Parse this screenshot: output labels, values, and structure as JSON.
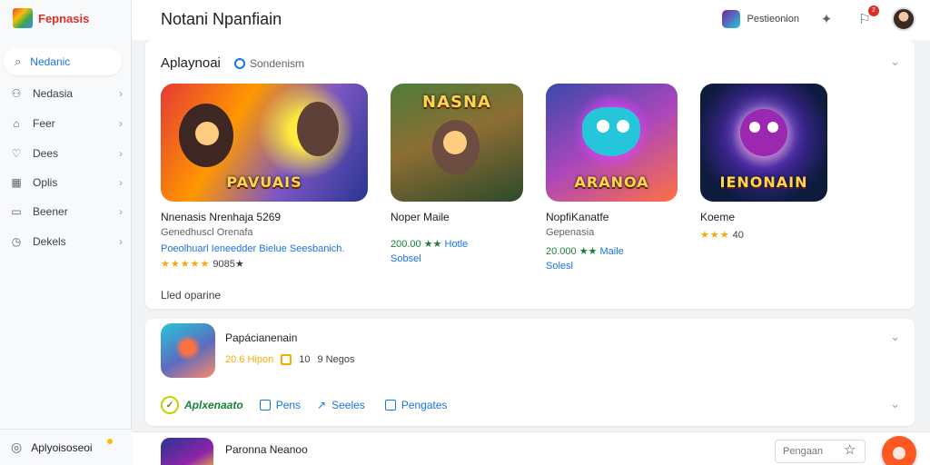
{
  "brand": {
    "name": "Fepnasis"
  },
  "search": {
    "label": "Nedanic"
  },
  "sidebar": {
    "items": [
      {
        "label": "Nedasia",
        "icon": "controller-icon"
      },
      {
        "label": "Feer",
        "icon": "tag-icon"
      },
      {
        "label": "Dees",
        "icon": "heart-icon"
      },
      {
        "label": "Oplis",
        "icon": "grid-icon"
      },
      {
        "label": "Beener",
        "icon": "briefcase-icon"
      },
      {
        "label": "Dekels",
        "icon": "clock-icon"
      }
    ],
    "bottom_label": "Aplyoisoseoi"
  },
  "header": {
    "title": "Notani Npanfiain",
    "app_label": "Pestieonion",
    "notification_count": "2"
  },
  "section1": {
    "title": "Aplaynoai",
    "subtitle": "Sondenism",
    "footer": "Lled oparine",
    "tiles": [
      {
        "art_text": "PAVUAIS",
        "name": "Nnenasis Nrenhaja 5269",
        "developer": "Genedhuscl Orenafa",
        "line": "Poeolhuarl Ieneedder Bielue Seesbanich.",
        "rating_prefix": "",
        "stars": "★★★★★",
        "rating_suffix": "9085★"
      },
      {
        "art_text": "NASNA",
        "name": "Noper Maile",
        "developer": "",
        "line": "",
        "rating_prefix": "200.00 ★★",
        "stars": "",
        "rating_suffix": "Hotle",
        "extra": "Sobsel"
      },
      {
        "art_text": "ARANOA",
        "name": "NopfiKanatfe",
        "developer": "Gepenasia",
        "line": "",
        "rating_prefix": "20.000 ★★",
        "stars": "",
        "rating_suffix": "Maile",
        "extra": "Solesl"
      },
      {
        "art_text": "IENONAIN",
        "name": "Koeme",
        "developer": "",
        "line": "",
        "rating_prefix": "",
        "stars": "★★★",
        "rating_suffix": "40"
      }
    ]
  },
  "section2": {
    "app_name": "Papácianenain",
    "meta_value": "20.6 Hipon",
    "meta_size": "10",
    "meta_count": "9 Negos",
    "brand_label": "Aplxenaato",
    "actions": [
      {
        "label": "Pens"
      },
      {
        "label": "Seeles"
      },
      {
        "label": "Pengates"
      }
    ]
  },
  "bottom": {
    "app_name": "Paronna Neanoo",
    "search_placeholder": "Pengaan"
  },
  "colors": {
    "accent": "#1a73e8",
    "brand_red": "#d93025",
    "rating": "#f9ab00",
    "fab": "#ff5722"
  }
}
